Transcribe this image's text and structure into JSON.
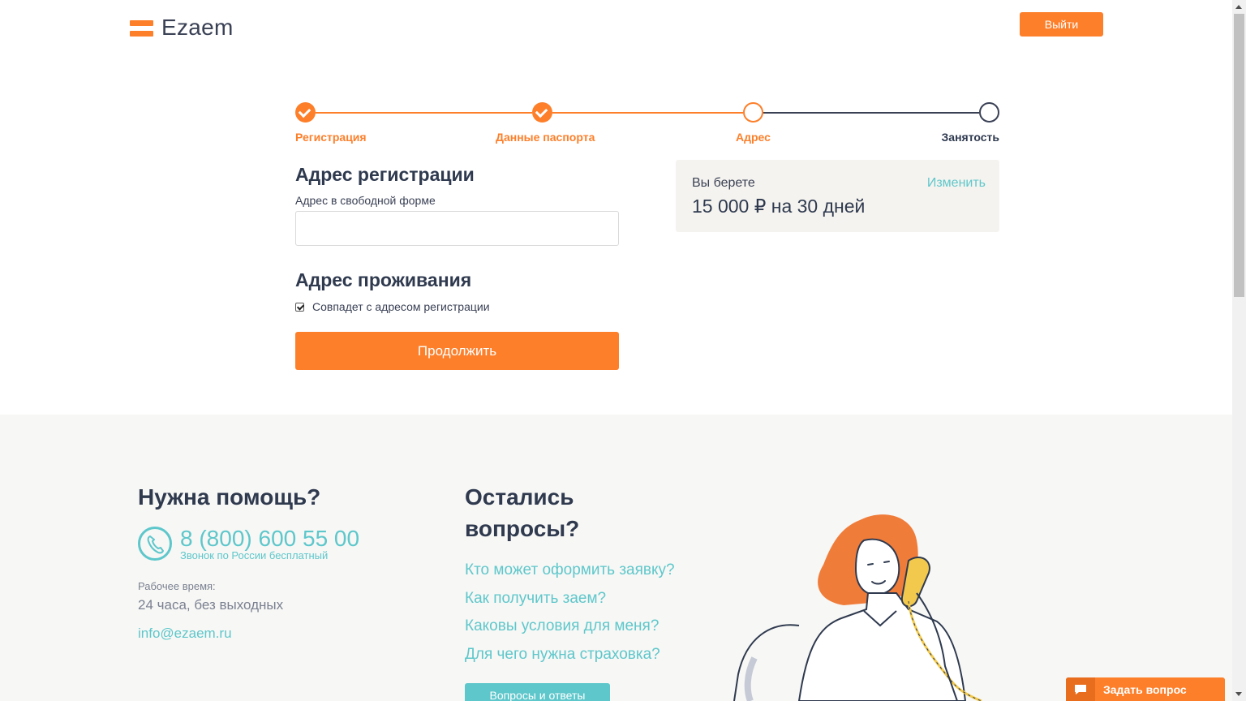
{
  "header": {
    "logo_text": "Ezaem",
    "logout_label": "Выйти"
  },
  "stepper": {
    "steps": [
      {
        "label": "Регистрация",
        "state": "done"
      },
      {
        "label": "Данные паспорта",
        "state": "done"
      },
      {
        "label": "Адрес",
        "state": "current"
      },
      {
        "label": "Занятость",
        "state": "todo"
      }
    ]
  },
  "form": {
    "registration_title": "Адрес регистрации",
    "free_form_label": "Адрес в свободной форме",
    "free_form_value": "",
    "residence_title": "Адрес проживания",
    "same_address_label": "Совпадет с адресом регистрации",
    "same_address_checked": true,
    "continue_label": "Продолжить"
  },
  "summary": {
    "caption": "Вы берете",
    "change_label": "Изменить",
    "amount": "15 000 ₽ на 30 дней"
  },
  "footer": {
    "help_title": "Нужна помощь?",
    "phone": "8 (800) 600 55 00",
    "phone_note": "Звонок по России бесплатный",
    "hours_label": "Рабочее время:",
    "hours_value": "24 часа, без выходных",
    "email": "info@ezaem.ru",
    "faq_title": "Остались вопросы?",
    "faq_links": [
      "Кто может оформить заявку?",
      "Как получить заем?",
      "Каковы условия для меня?",
      "Для чего нужна страховка?"
    ],
    "faq_button": "Вопросы и ответы",
    "ask_button": "Задать вопрос"
  },
  "colors": {
    "accent_orange": "#fd7f2a",
    "accent_teal": "#5ec7cb",
    "text_dark": "#2f3a4f"
  }
}
